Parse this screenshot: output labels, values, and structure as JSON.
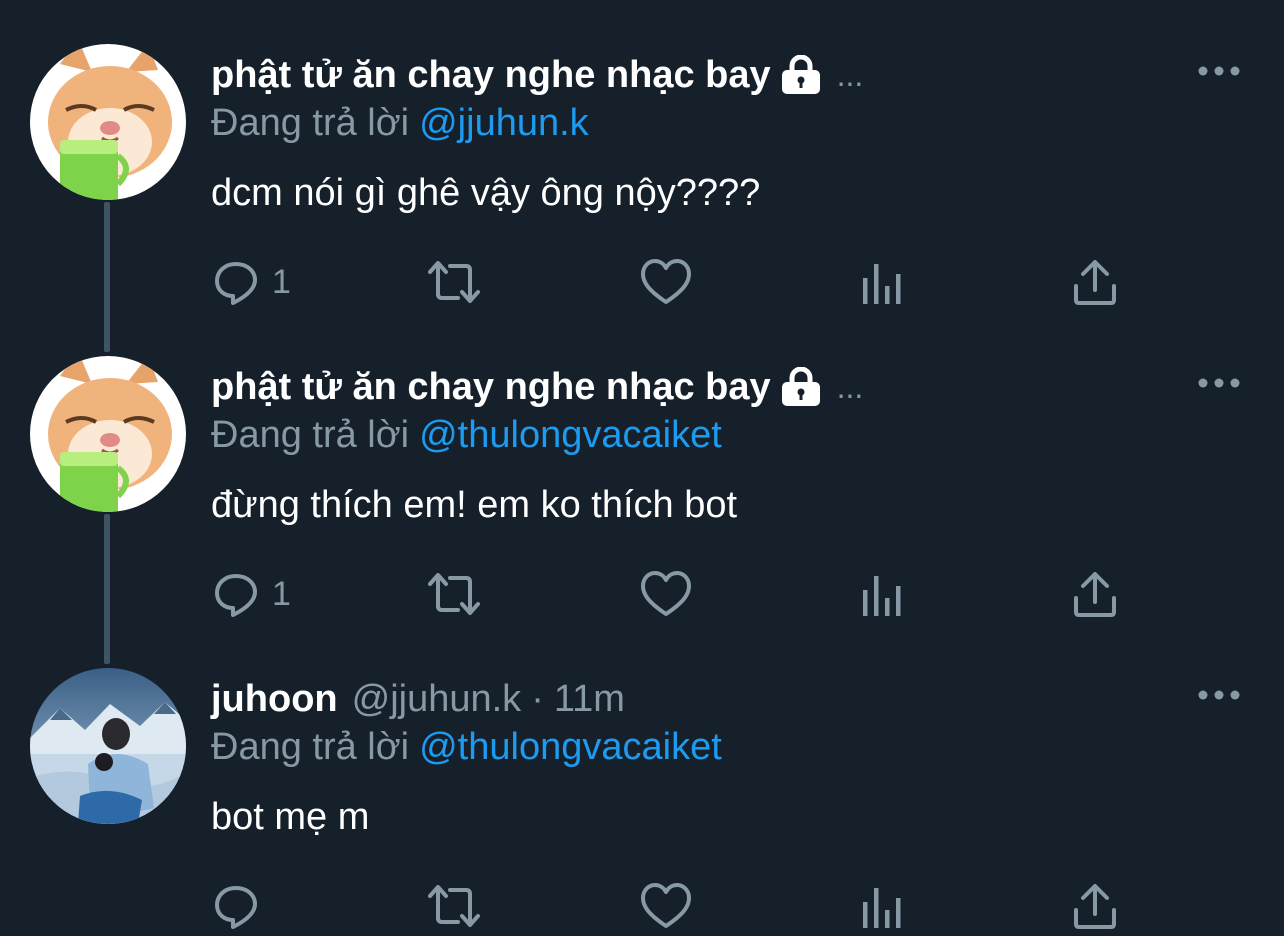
{
  "theme": {
    "background": "#15202b",
    "text": "#ffffff",
    "secondary": "#8899a6",
    "link": "#1d9bf0",
    "thread_line": "#3d5466"
  },
  "tweets": [
    {
      "display_name": "phật tử ăn chay nghe nhạc bay",
      "protected": true,
      "truncation": "...",
      "handle": "",
      "time": "",
      "reply_prefix": "Đang trả lời",
      "reply_to": "@jjuhun.k",
      "text": "dcm nói gì ghê vậy ông nộy????",
      "reply_count": "1",
      "avatar": "cat-with-matcha-avatar"
    },
    {
      "display_name": "phật tử ăn chay nghe nhạc bay",
      "protected": true,
      "truncation": "...",
      "handle": "",
      "time": "",
      "reply_prefix": "Đang trả lời",
      "reply_to": "@thulongvacaiket",
      "text": "đừng thích em! em ko thích bot",
      "reply_count": "1",
      "avatar": "cat-with-matcha-avatar"
    },
    {
      "display_name": "juhoon",
      "protected": false,
      "truncation": "",
      "handle": "@jjuhun.k",
      "separator": "·",
      "time": "11m",
      "reply_prefix": "Đang trả lời",
      "reply_to": "@thulongvacaiket",
      "text": "bot mẹ m",
      "reply_count": "",
      "avatar": "snow-mountain-person-avatar"
    }
  ],
  "icons": [
    "reply-icon",
    "retweet-icon",
    "like-icon",
    "analytics-icon",
    "share-icon",
    "more-icon",
    "lock-icon"
  ]
}
